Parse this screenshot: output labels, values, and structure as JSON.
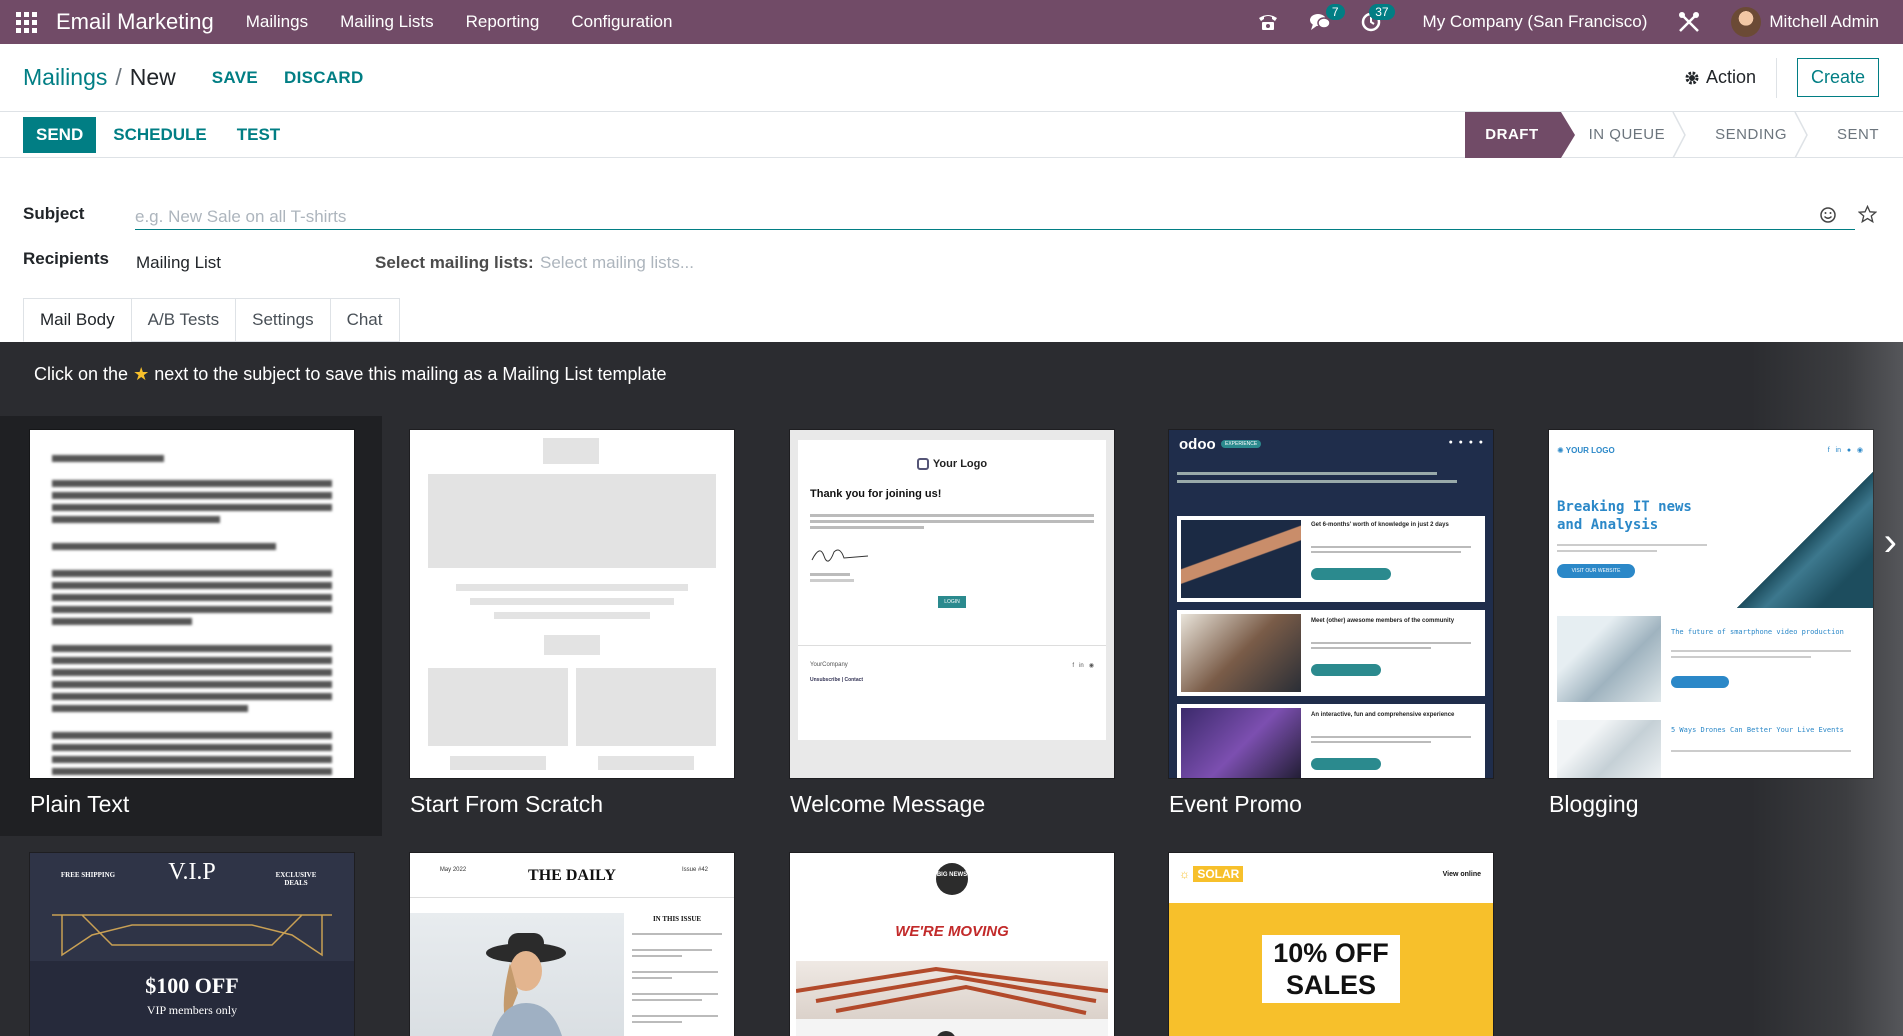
{
  "navbar": {
    "app_name": "Email Marketing",
    "menu": [
      "Mailings",
      "Mailing Lists",
      "Reporting",
      "Configuration"
    ],
    "messages_count": "7",
    "activities_count": "37",
    "company": "My Company (San Francisco)",
    "user": "Mitchell Admin"
  },
  "breadcrumb": {
    "parent": "Mailings",
    "current": "New"
  },
  "control": {
    "save": "SAVE",
    "discard": "DISCARD",
    "action": "Action",
    "create": "Create"
  },
  "statusbar": {
    "send": "SEND",
    "schedule": "SCHEDULE",
    "test": "TEST",
    "stages": [
      "DRAFT",
      "IN QUEUE",
      "SENDING",
      "SENT"
    ],
    "active_stage": "DRAFT"
  },
  "form": {
    "subject_label": "Subject",
    "subject_placeholder": "e.g. New Sale on all T-shirts",
    "recipients_label": "Recipients",
    "recipients_value": "Mailing List",
    "mailing_lists_label": "Select mailing lists:",
    "mailing_lists_placeholder": "Select mailing lists..."
  },
  "tabs": [
    "Mail Body",
    "A/B Tests",
    "Settings",
    "Chat"
  ],
  "body": {
    "hint_before": "Click on the",
    "hint_after": "next to the subject to save this mailing as a Mailing List template",
    "templates": [
      "Plain Text",
      "Start From Scratch",
      "Welcome Message",
      "Event Promo",
      "Blogging"
    ],
    "welcome": {
      "logo": "Your Logo",
      "heading": "Thank you for joining us!",
      "button": "LOGIN",
      "company": "YourCompany",
      "unsubscribe": "Unsubscribe | Contact"
    },
    "event": {
      "brand": "odoo",
      "tag": "EXPERIENCE",
      "items": [
        "Get 6-months' worth of knowledge in just 2 days",
        "Meet (other) awesome members of the community",
        "An interactive, fun and comprehensive experience"
      ]
    },
    "blog": {
      "logo": "YOUR LOGO",
      "headline": "Breaking IT news and Analysis",
      "button": "VISIT OUR WEBSITE",
      "post1": "The future of smartphone video production",
      "post2": "5 Ways Drones Can Better Your Live Events"
    },
    "vip": {
      "left": "FREE SHIPPING",
      "title": "V.I.P",
      "right": "EXCLUSIVE DEALS",
      "offer": "$100 OFF",
      "sub": "VIP members only"
    },
    "daily": {
      "month": "May 2022",
      "title": "THE DAILY",
      "issue": "Issue #42",
      "section": "IN THIS ISSUE"
    },
    "moving": {
      "logo": "BIG NEWS",
      "headline": "WE'RE MOVING"
    },
    "solar": {
      "brand": "SOLAR",
      "view": "View online",
      "offer_1": "10% OFF",
      "offer_2": "SALES"
    }
  },
  "colors": {
    "navbar": "#714b67",
    "accent": "#017e84",
    "dark_bg": "#2b2c30",
    "star": "#f7c02b",
    "solar": "#f7c02b"
  }
}
